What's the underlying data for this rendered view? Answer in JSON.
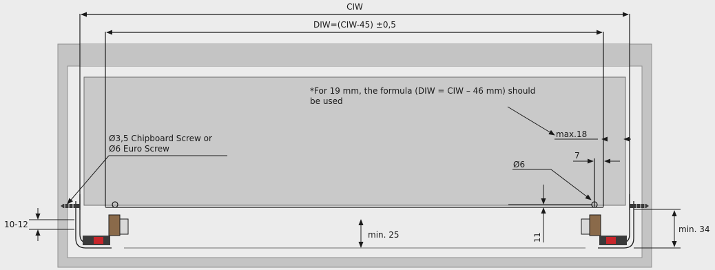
{
  "labels": {
    "ciw": "CIW",
    "diw_formula": "DIW=(CIW-45) ±0,5",
    "note_line1": "*For 19 mm, the formula (DIW = CIW – 46 mm) should",
    "note_line2": "be used",
    "screw_line1": "Ø3,5 Chipboard Screw or",
    "screw_line2": "Ø6 Euro Screw",
    "max18": "max.18",
    "seven": "7",
    "dia6": "Ø6",
    "height_10_12": "10-12",
    "min25": "min. 25",
    "eleven": "11",
    "min34": "min. 34"
  },
  "colors": {
    "background": "#ececec",
    "cabinet_frame": "#c4c4c4",
    "drawer_panel": "#c9c9c9",
    "line": "#1a1a1a",
    "runner_red": "#c8262b",
    "runner_dark": "#3a3a3a",
    "bracket_brown": "#8a6a4a"
  }
}
